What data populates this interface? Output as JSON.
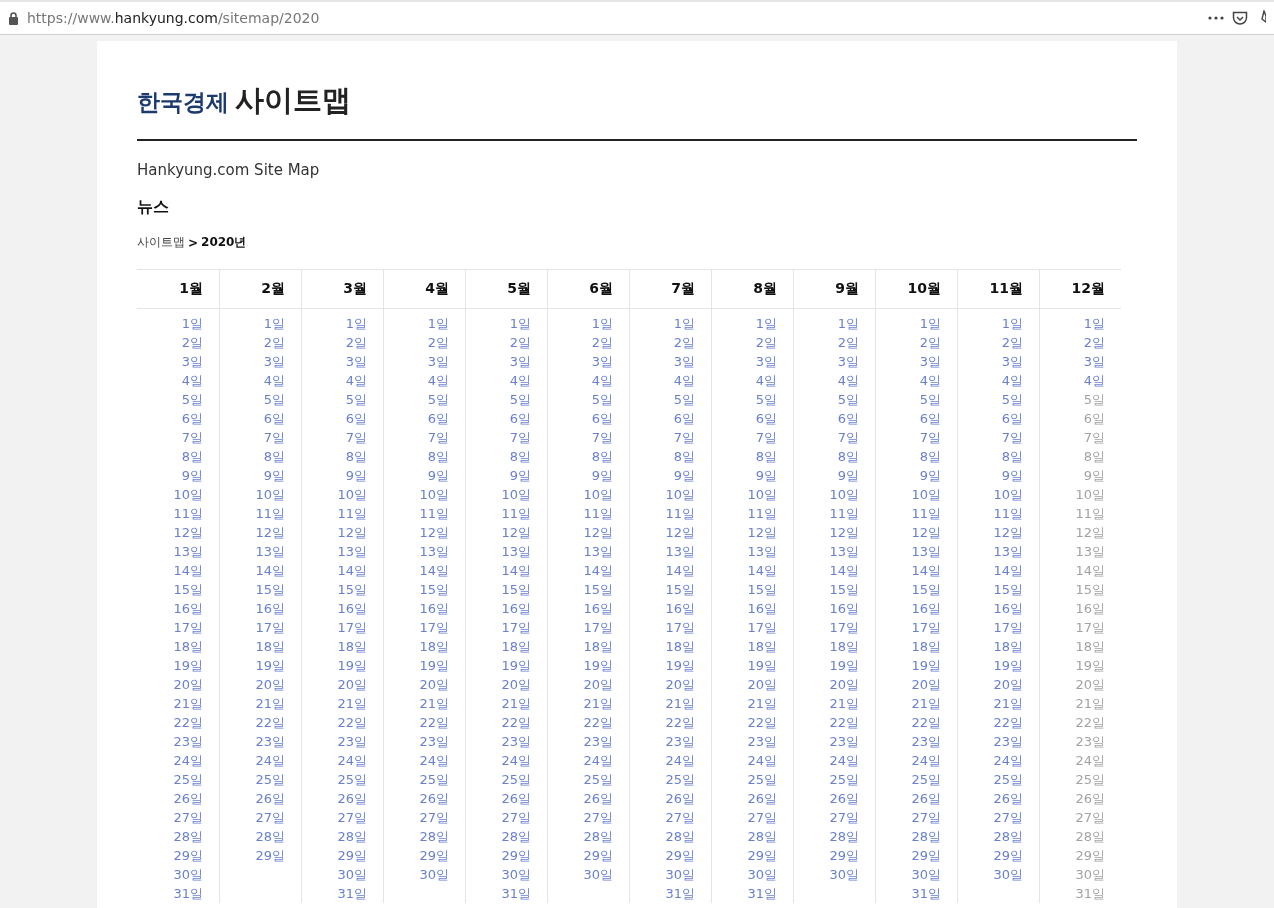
{
  "browser": {
    "url_host_prefix": "https://www.",
    "url_host": "hankyung.com",
    "url_path": "/sitemap/2020"
  },
  "header": {
    "brand": "한국경제",
    "title": "사이트맵"
  },
  "subtitle": "Hankyung.com Site Map",
  "section_title": "뉴스",
  "breadcrumb": {
    "parent": "사이트맵",
    "separator": ">",
    "current": "2020년"
  },
  "months": [
    {
      "label": "1월",
      "active_days": [
        "1일",
        "2일",
        "3일",
        "4일",
        "5일",
        "6일",
        "7일",
        "8일",
        "9일",
        "10일",
        "11일",
        "12일",
        "13일",
        "14일",
        "15일",
        "16일",
        "17일",
        "18일",
        "19일",
        "20일",
        "21일",
        "22일",
        "23일",
        "24일",
        "25일",
        "26일",
        "27일",
        "28일",
        "29일",
        "30일",
        "31일"
      ]
    },
    {
      "label": "2월",
      "active_days": [
        "1일",
        "2일",
        "3일",
        "4일",
        "5일",
        "6일",
        "7일",
        "8일",
        "9일",
        "10일",
        "11일",
        "12일",
        "13일",
        "14일",
        "15일",
        "16일",
        "17일",
        "18일",
        "19일",
        "20일",
        "21일",
        "22일",
        "23일",
        "24일",
        "25일",
        "26일",
        "27일",
        "28일",
        "29일"
      ]
    },
    {
      "label": "3월",
      "active_days": [
        "1일",
        "2일",
        "3일",
        "4일",
        "5일",
        "6일",
        "7일",
        "8일",
        "9일",
        "10일",
        "11일",
        "12일",
        "13일",
        "14일",
        "15일",
        "16일",
        "17일",
        "18일",
        "19일",
        "20일",
        "21일",
        "22일",
        "23일",
        "24일",
        "25일",
        "26일",
        "27일",
        "28일",
        "29일",
        "30일",
        "31일"
      ]
    },
    {
      "label": "4월",
      "active_days": [
        "1일",
        "2일",
        "3일",
        "4일",
        "5일",
        "6일",
        "7일",
        "8일",
        "9일",
        "10일",
        "11일",
        "12일",
        "13일",
        "14일",
        "15일",
        "16일",
        "17일",
        "18일",
        "19일",
        "20일",
        "21일",
        "22일",
        "23일",
        "24일",
        "25일",
        "26일",
        "27일",
        "28일",
        "29일",
        "30일"
      ]
    },
    {
      "label": "5월",
      "active_days": [
        "1일",
        "2일",
        "3일",
        "4일",
        "5일",
        "6일",
        "7일",
        "8일",
        "9일",
        "10일",
        "11일",
        "12일",
        "13일",
        "14일",
        "15일",
        "16일",
        "17일",
        "18일",
        "19일",
        "20일",
        "21일",
        "22일",
        "23일",
        "24일",
        "25일",
        "26일",
        "27일",
        "28일",
        "29일",
        "30일",
        "31일"
      ]
    },
    {
      "label": "6월",
      "active_days": [
        "1일",
        "2일",
        "3일",
        "4일",
        "5일",
        "6일",
        "7일",
        "8일",
        "9일",
        "10일",
        "11일",
        "12일",
        "13일",
        "14일",
        "15일",
        "16일",
        "17일",
        "18일",
        "19일",
        "20일",
        "21일",
        "22일",
        "23일",
        "24일",
        "25일",
        "26일",
        "27일",
        "28일",
        "29일",
        "30일"
      ]
    },
    {
      "label": "7월",
      "active_days": [
        "1일",
        "2일",
        "3일",
        "4일",
        "5일",
        "6일",
        "7일",
        "8일",
        "9일",
        "10일",
        "11일",
        "12일",
        "13일",
        "14일",
        "15일",
        "16일",
        "17일",
        "18일",
        "19일",
        "20일",
        "21일",
        "22일",
        "23일",
        "24일",
        "25일",
        "26일",
        "27일",
        "28일",
        "29일",
        "30일",
        "31일"
      ]
    },
    {
      "label": "8월",
      "active_days": [
        "1일",
        "2일",
        "3일",
        "4일",
        "5일",
        "6일",
        "7일",
        "8일",
        "9일",
        "10일",
        "11일",
        "12일",
        "13일",
        "14일",
        "15일",
        "16일",
        "17일",
        "18일",
        "19일",
        "20일",
        "21일",
        "22일",
        "23일",
        "24일",
        "25일",
        "26일",
        "27일",
        "28일",
        "29일",
        "30일",
        "31일"
      ]
    },
    {
      "label": "9월",
      "active_days": [
        "1일",
        "2일",
        "3일",
        "4일",
        "5일",
        "6일",
        "7일",
        "8일",
        "9일",
        "10일",
        "11일",
        "12일",
        "13일",
        "14일",
        "15일",
        "16일",
        "17일",
        "18일",
        "19일",
        "20일",
        "21일",
        "22일",
        "23일",
        "24일",
        "25일",
        "26일",
        "27일",
        "28일",
        "29일",
        "30일"
      ]
    },
    {
      "label": "10월",
      "active_days": [
        "1일",
        "2일",
        "3일",
        "4일",
        "5일",
        "6일",
        "7일",
        "8일",
        "9일",
        "10일",
        "11일",
        "12일",
        "13일",
        "14일",
        "15일",
        "16일",
        "17일",
        "18일",
        "19일",
        "20일",
        "21일",
        "22일",
        "23일",
        "24일",
        "25일",
        "26일",
        "27일",
        "28일",
        "29일",
        "30일",
        "31일"
      ]
    },
    {
      "label": "11월",
      "active_days": [
        "1일",
        "2일",
        "3일",
        "4일",
        "5일",
        "6일",
        "7일",
        "8일",
        "9일",
        "10일",
        "11일",
        "12일",
        "13일",
        "14일",
        "15일",
        "16일",
        "17일",
        "18일",
        "19일",
        "20일",
        "21일",
        "22일",
        "23일",
        "24일",
        "25일",
        "26일",
        "27일",
        "28일",
        "29일",
        "30일"
      ]
    },
    {
      "label": "12월",
      "active_days": [
        "1일",
        "2일",
        "3일",
        "4일"
      ],
      "inactive_days": [
        "5일",
        "6일",
        "7일",
        "8일",
        "9일",
        "10일",
        "11일",
        "12일",
        "13일",
        "14일",
        "15일",
        "16일",
        "17일",
        "18일",
        "19일",
        "20일",
        "21일",
        "22일",
        "23일",
        "24일",
        "25일",
        "26일",
        "27일",
        "28일",
        "29일",
        "30일",
        "31일"
      ]
    }
  ]
}
